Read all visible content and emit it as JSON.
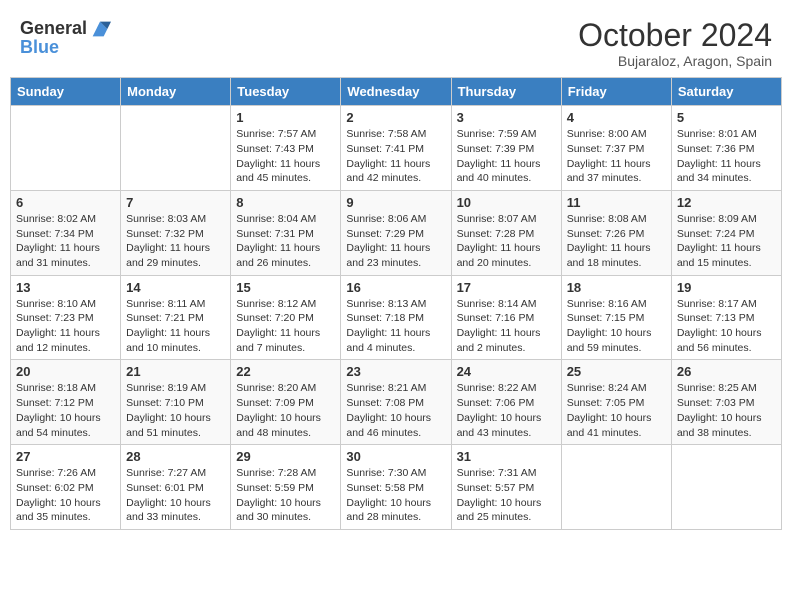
{
  "header": {
    "logo_line1": "General",
    "logo_line2": "Blue",
    "month_title": "October 2024",
    "location": "Bujaraloz, Aragon, Spain"
  },
  "weekdays": [
    "Sunday",
    "Monday",
    "Tuesday",
    "Wednesday",
    "Thursday",
    "Friday",
    "Saturday"
  ],
  "weeks": [
    [
      {
        "day": "",
        "info": ""
      },
      {
        "day": "",
        "info": ""
      },
      {
        "day": "1",
        "info": "Sunrise: 7:57 AM\nSunset: 7:43 PM\nDaylight: 11 hours and 45 minutes."
      },
      {
        "day": "2",
        "info": "Sunrise: 7:58 AM\nSunset: 7:41 PM\nDaylight: 11 hours and 42 minutes."
      },
      {
        "day": "3",
        "info": "Sunrise: 7:59 AM\nSunset: 7:39 PM\nDaylight: 11 hours and 40 minutes."
      },
      {
        "day": "4",
        "info": "Sunrise: 8:00 AM\nSunset: 7:37 PM\nDaylight: 11 hours and 37 minutes."
      },
      {
        "day": "5",
        "info": "Sunrise: 8:01 AM\nSunset: 7:36 PM\nDaylight: 11 hours and 34 minutes."
      }
    ],
    [
      {
        "day": "6",
        "info": "Sunrise: 8:02 AM\nSunset: 7:34 PM\nDaylight: 11 hours and 31 minutes."
      },
      {
        "day": "7",
        "info": "Sunrise: 8:03 AM\nSunset: 7:32 PM\nDaylight: 11 hours and 29 minutes."
      },
      {
        "day": "8",
        "info": "Sunrise: 8:04 AM\nSunset: 7:31 PM\nDaylight: 11 hours and 26 minutes."
      },
      {
        "day": "9",
        "info": "Sunrise: 8:06 AM\nSunset: 7:29 PM\nDaylight: 11 hours and 23 minutes."
      },
      {
        "day": "10",
        "info": "Sunrise: 8:07 AM\nSunset: 7:28 PM\nDaylight: 11 hours and 20 minutes."
      },
      {
        "day": "11",
        "info": "Sunrise: 8:08 AM\nSunset: 7:26 PM\nDaylight: 11 hours and 18 minutes."
      },
      {
        "day": "12",
        "info": "Sunrise: 8:09 AM\nSunset: 7:24 PM\nDaylight: 11 hours and 15 minutes."
      }
    ],
    [
      {
        "day": "13",
        "info": "Sunrise: 8:10 AM\nSunset: 7:23 PM\nDaylight: 11 hours and 12 minutes."
      },
      {
        "day": "14",
        "info": "Sunrise: 8:11 AM\nSunset: 7:21 PM\nDaylight: 11 hours and 10 minutes."
      },
      {
        "day": "15",
        "info": "Sunrise: 8:12 AM\nSunset: 7:20 PM\nDaylight: 11 hours and 7 minutes."
      },
      {
        "day": "16",
        "info": "Sunrise: 8:13 AM\nSunset: 7:18 PM\nDaylight: 11 hours and 4 minutes."
      },
      {
        "day": "17",
        "info": "Sunrise: 8:14 AM\nSunset: 7:16 PM\nDaylight: 11 hours and 2 minutes."
      },
      {
        "day": "18",
        "info": "Sunrise: 8:16 AM\nSunset: 7:15 PM\nDaylight: 10 hours and 59 minutes."
      },
      {
        "day": "19",
        "info": "Sunrise: 8:17 AM\nSunset: 7:13 PM\nDaylight: 10 hours and 56 minutes."
      }
    ],
    [
      {
        "day": "20",
        "info": "Sunrise: 8:18 AM\nSunset: 7:12 PM\nDaylight: 10 hours and 54 minutes."
      },
      {
        "day": "21",
        "info": "Sunrise: 8:19 AM\nSunset: 7:10 PM\nDaylight: 10 hours and 51 minutes."
      },
      {
        "day": "22",
        "info": "Sunrise: 8:20 AM\nSunset: 7:09 PM\nDaylight: 10 hours and 48 minutes."
      },
      {
        "day": "23",
        "info": "Sunrise: 8:21 AM\nSunset: 7:08 PM\nDaylight: 10 hours and 46 minutes."
      },
      {
        "day": "24",
        "info": "Sunrise: 8:22 AM\nSunset: 7:06 PM\nDaylight: 10 hours and 43 minutes."
      },
      {
        "day": "25",
        "info": "Sunrise: 8:24 AM\nSunset: 7:05 PM\nDaylight: 10 hours and 41 minutes."
      },
      {
        "day": "26",
        "info": "Sunrise: 8:25 AM\nSunset: 7:03 PM\nDaylight: 10 hours and 38 minutes."
      }
    ],
    [
      {
        "day": "27",
        "info": "Sunrise: 7:26 AM\nSunset: 6:02 PM\nDaylight: 10 hours and 35 minutes."
      },
      {
        "day": "28",
        "info": "Sunrise: 7:27 AM\nSunset: 6:01 PM\nDaylight: 10 hours and 33 minutes."
      },
      {
        "day": "29",
        "info": "Sunrise: 7:28 AM\nSunset: 5:59 PM\nDaylight: 10 hours and 30 minutes."
      },
      {
        "day": "30",
        "info": "Sunrise: 7:30 AM\nSunset: 5:58 PM\nDaylight: 10 hours and 28 minutes."
      },
      {
        "day": "31",
        "info": "Sunrise: 7:31 AM\nSunset: 5:57 PM\nDaylight: 10 hours and 25 minutes."
      },
      {
        "day": "",
        "info": ""
      },
      {
        "day": "",
        "info": ""
      }
    ]
  ]
}
